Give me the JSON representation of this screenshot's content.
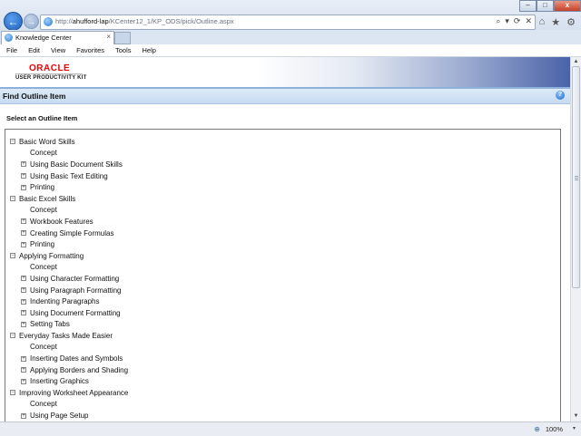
{
  "browser": {
    "url_prefix": "http://",
    "url_domain": "ahufford-lap",
    "url_path": "/KCenter12_1/KP_ODS/pick/Outline.aspx",
    "tab_title": "Knowledge Center",
    "tab_close": "×",
    "address_icons": [
      "⌕",
      "▾",
      "⟳",
      "✕"
    ],
    "right_icons": [
      "⌂",
      "★",
      "⚙"
    ],
    "window_controls": [
      "–",
      "□",
      "x"
    ],
    "back": "←",
    "forward": "→"
  },
  "menu": [
    "File",
    "Edit",
    "View",
    "Favorites",
    "Tools",
    "Help"
  ],
  "banner": {
    "logo": "ORACLE",
    "subtitle": "USER PRODUCTIVITY KIT"
  },
  "header": {
    "title": "Find Outline Item",
    "help": "?"
  },
  "select_label": "Select an Outline Item",
  "tree": [
    {
      "level": 0,
      "toggle": "⊟",
      "label": "Basic Word Skills"
    },
    {
      "level": 1,
      "toggle": "",
      "label": "Concept"
    },
    {
      "level": 1,
      "toggle": "⊞",
      "label": "Using Basic Document Skills"
    },
    {
      "level": 1,
      "toggle": "⊞",
      "label": "Using Basic Text Editing"
    },
    {
      "level": 1,
      "toggle": "⊞",
      "label": "Printing"
    },
    {
      "level": 0,
      "toggle": "⊟",
      "label": "Basic Excel Skills"
    },
    {
      "level": 1,
      "toggle": "",
      "label": "Concept"
    },
    {
      "level": 1,
      "toggle": "⊞",
      "label": "Workbook Features"
    },
    {
      "level": 1,
      "toggle": "⊞",
      "label": "Creating Simple Formulas"
    },
    {
      "level": 1,
      "toggle": "⊞",
      "label": "Printing"
    },
    {
      "level": 0,
      "toggle": "⊟",
      "label": "Applying Formatting"
    },
    {
      "level": 1,
      "toggle": "",
      "label": "Concept"
    },
    {
      "level": 1,
      "toggle": "⊞",
      "label": "Using Character Formatting"
    },
    {
      "level": 1,
      "toggle": "⊞",
      "label": "Using Paragraph Formatting"
    },
    {
      "level": 1,
      "toggle": "⊞",
      "label": "Indenting Paragraphs"
    },
    {
      "level": 1,
      "toggle": "⊞",
      "label": "Using Document Formatting"
    },
    {
      "level": 1,
      "toggle": "⊞",
      "label": "Setting Tabs"
    },
    {
      "level": 0,
      "toggle": "⊟",
      "label": "Everyday Tasks Made Easier"
    },
    {
      "level": 1,
      "toggle": "",
      "label": "Concept"
    },
    {
      "level": 1,
      "toggle": "⊞",
      "label": "Inserting Dates and Symbols"
    },
    {
      "level": 1,
      "toggle": "⊞",
      "label": "Applying Borders and Shading"
    },
    {
      "level": 1,
      "toggle": "⊞",
      "label": "Inserting Graphics"
    },
    {
      "level": 0,
      "toggle": "⊟",
      "label": "Improving Worksheet Appearance"
    },
    {
      "level": 1,
      "toggle": "",
      "label": "Concept"
    },
    {
      "level": 1,
      "toggle": "⊞",
      "label": "Using Page Setup"
    }
  ],
  "status": {
    "zoom": "100%",
    "zoom_icon": "⊕",
    "zoom_arrow": "▾"
  },
  "scrollbar": {
    "up": "▲",
    "down": "▼"
  }
}
